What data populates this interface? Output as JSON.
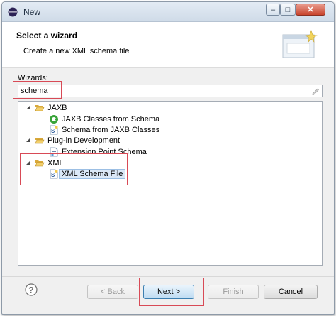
{
  "window": {
    "title": "New",
    "controls": {
      "minimize": "–",
      "maximize": "□",
      "close": "✕"
    }
  },
  "header": {
    "title": "Select a wizard",
    "description": "Create a new XML schema file"
  },
  "wizards": {
    "label_prefix": "W",
    "label_rest": "izards:",
    "filter_value": "schema"
  },
  "tree": {
    "groups": [
      {
        "label": "JAXB",
        "expanded": true,
        "icon": "folder-open-icon",
        "items": [
          {
            "label": "JAXB Classes from Schema",
            "icon": "jaxb-classes-icon"
          },
          {
            "label": "Schema from JAXB Classes",
            "icon": "schema-file-icon"
          }
        ]
      },
      {
        "label": "Plug-in Development",
        "expanded": true,
        "icon": "folder-open-icon",
        "items": [
          {
            "label": "Extension Point Schema",
            "icon": "extension-point-icon"
          }
        ]
      },
      {
        "label": "XML",
        "expanded": true,
        "icon": "folder-open-icon",
        "items": [
          {
            "label": "XML Schema File",
            "icon": "schema-file-icon",
            "selected": true
          }
        ]
      }
    ]
  },
  "buttons": {
    "back": {
      "prefix": "< ",
      "mnemonic": "B",
      "rest": "ack",
      "enabled": false
    },
    "next": {
      "mnemonic": "N",
      "rest": "ext >",
      "enabled": true
    },
    "finish": {
      "mnemonic": "F",
      "rest": "inish",
      "enabled": false
    },
    "cancel": {
      "label": "Cancel",
      "enabled": true
    }
  },
  "colors": {
    "highlight_box": "#d84a56",
    "selection": "#dbe8f7",
    "folder": "#e8c15a"
  }
}
